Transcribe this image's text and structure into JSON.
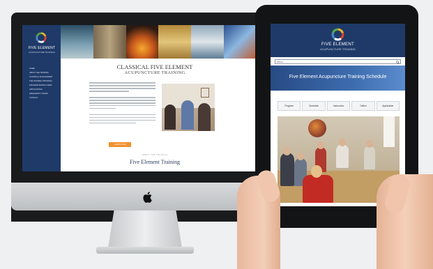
{
  "colors": {
    "brand_navy": "#1f3a68",
    "accent_orange": "#f1912d",
    "background": "#eef0f1"
  },
  "desktop": {
    "brand_name": "FIVE ELEMENT",
    "brand_sub": "ACUPUNCTURE TRAINING",
    "nav_items": [
      "HOME",
      "ABOUT THE TRAINING",
      "CLASSICAL FIVE ELEMENT",
      "THE TRAINING PROGRAM",
      "PROGRAM DATES & FEES",
      "APPLICATIONS",
      "FREQUENTLY ASKED",
      "CONTACT"
    ],
    "title": "CLASSICAL FIVE ELEMENT",
    "subtitle": "ACUPUNCTURE TRAINING",
    "button_label": "LEARN MORE",
    "small_label": "ABOUT THE TRAINING",
    "section_title": "Five Element Training"
  },
  "tablet": {
    "brand_name": "FIVE ELEMENT",
    "brand_sub": "ACUPUNCTURE TRAINING",
    "search_placeholder": "Menu",
    "hero_title": "Five Element Acupuncture Training Schedule",
    "tabs": [
      "Program",
      "Schedule",
      "Instructors",
      "Tuition",
      "Application"
    ]
  },
  "icons": {
    "logo": "five-element-ring-icon",
    "search": "search-icon",
    "apple": "apple-logo-icon"
  }
}
